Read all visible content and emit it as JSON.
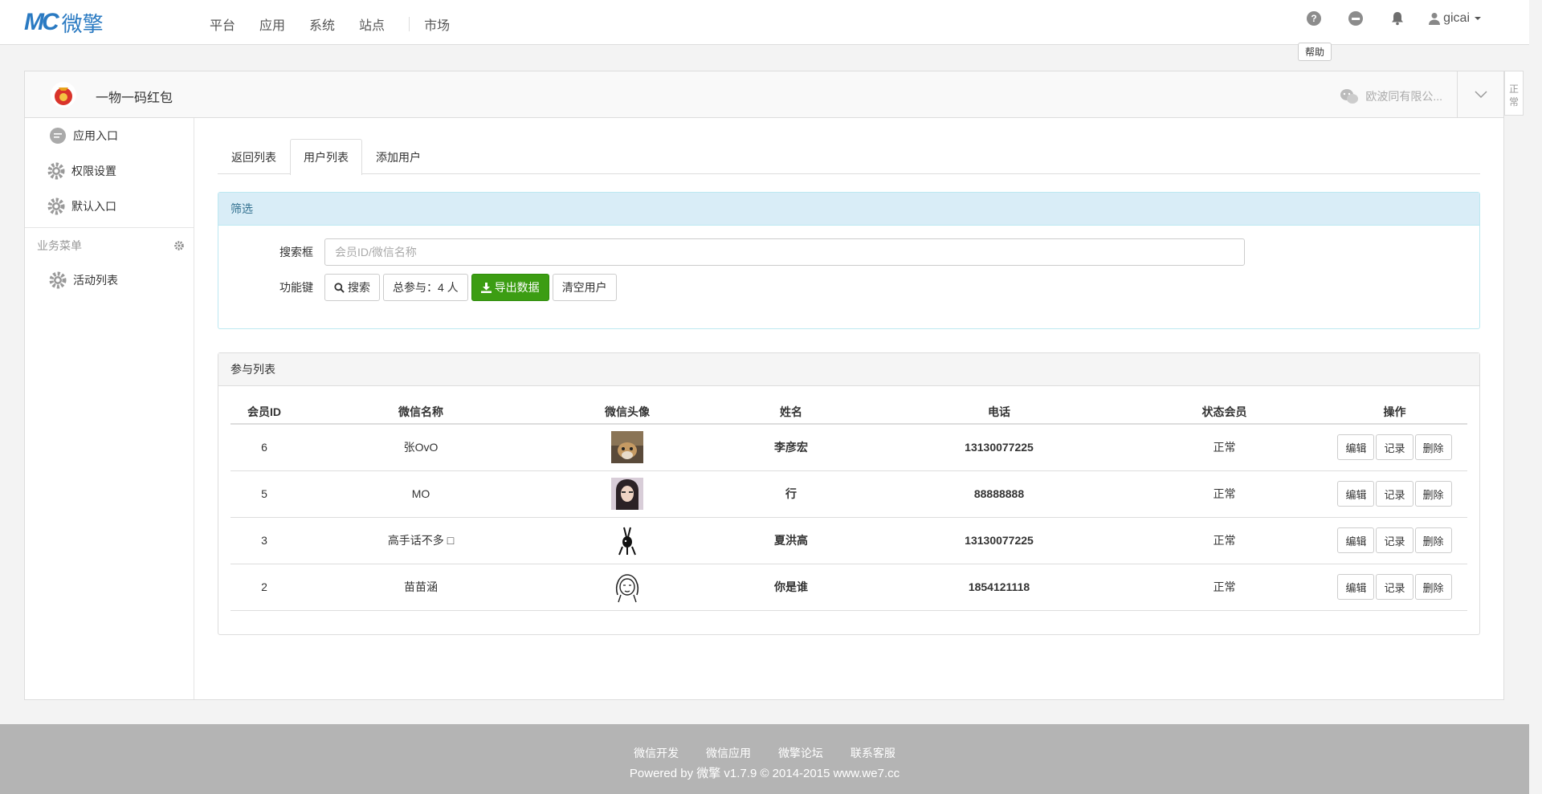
{
  "topnav": {
    "logo_mark": "MC",
    "logo_text": "微擎",
    "links": [
      "平台",
      "应用",
      "系统",
      "站点",
      "市场"
    ],
    "help_tooltip": "帮助",
    "username": "gicai"
  },
  "app": {
    "title": "一物一码红包",
    "account": "欧波同有限公...",
    "side_tag": "正常"
  },
  "sidebar": {
    "items": [
      "应用入口",
      "权限设置",
      "默认入口"
    ],
    "group_title": "业务菜单",
    "group_items": [
      "活动列表"
    ]
  },
  "tabs": [
    "返回列表",
    "用户列表",
    "添加用户"
  ],
  "filter": {
    "title": "筛选",
    "search_label": "搜索框",
    "search_placeholder": "会员ID/微信名称",
    "func_label": "功能键",
    "btn_search": "搜索",
    "btn_total": "总参与：4 人",
    "btn_export": "导出数据",
    "btn_clear": "清空用户"
  },
  "list": {
    "title": "参与列表",
    "headers": [
      "会员ID",
      "微信名称",
      "微信头像",
      "姓名",
      "电话",
      "状态会员",
      "操作"
    ],
    "rows": [
      {
        "id": "6",
        "nickname": "张OvO",
        "name": "李彦宏",
        "phone": "13130077225",
        "status": "正常"
      },
      {
        "id": "5",
        "nickname": "MO",
        "name": "行",
        "phone": "88888888",
        "status": "正常"
      },
      {
        "id": "3",
        "nickname": "高手话不多 □",
        "name": "夏洪高",
        "phone": "13130077225",
        "status": "正常"
      },
      {
        "id": "2",
        "nickname": "苗苗涵",
        "name": "你是谁",
        "phone": "1854121118",
        "status": "正常"
      }
    ],
    "op_edit": "编辑",
    "op_log": "记录",
    "op_delete": "删除"
  },
  "footer": {
    "links": [
      "微信开发",
      "微信应用",
      "微擎论坛",
      "联系客服"
    ],
    "copyright": "Powered by 微擎 v1.7.9 © 2014-2015 www.we7.cc"
  }
}
